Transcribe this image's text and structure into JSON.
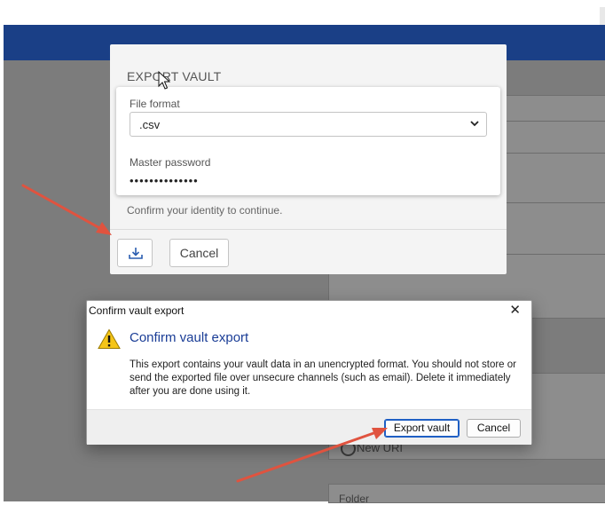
{
  "export_dialog": {
    "title": "EXPORT VAULT",
    "file_format_label": "File format",
    "file_format_value": ".csv",
    "master_password_label": "Master password",
    "master_password_value": "••••••••••••••",
    "confirm_text": "Confirm your identity to continue.",
    "cancel_label": "Cancel",
    "download_icon": "download-icon"
  },
  "confirm_dialog": {
    "window_title": "Confirm vault export",
    "close_glyph": "✕",
    "heading": "Confirm vault export",
    "message": "This export contains your vault data in an unencrypted format. You should not store or send the exported file over unsecure channels (such as email). Delete it immediately after you are done using it.",
    "export_button_label": "Export vault",
    "cancel_button_label": "Cancel",
    "warning_icon": "warning-icon"
  },
  "background": {
    "new_uri_label": "New URI",
    "folder_label": "Folder"
  },
  "colors": {
    "app_header": "#1a3f86",
    "heading_blue": "#1a3d96",
    "annotation_red": "#e0533f"
  }
}
